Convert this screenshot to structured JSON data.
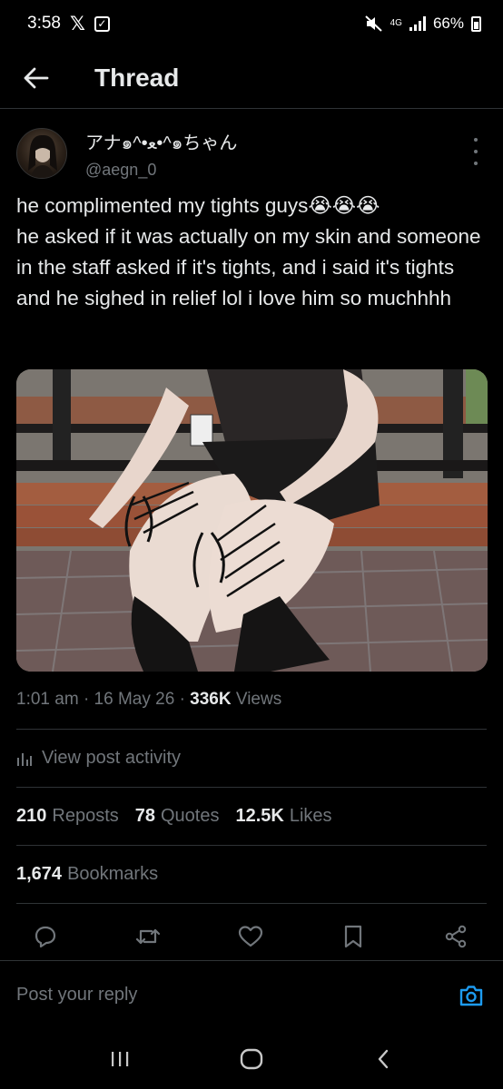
{
  "status_bar": {
    "time": "3:58",
    "network": "4G",
    "battery": "66%"
  },
  "header": {
    "title": "Thread"
  },
  "author": {
    "display_name": "アナ๑^•ﻌ•^๑ちゃん",
    "handle": "@aegn_0"
  },
  "post": {
    "text": "he complimented my tights guys😭😭😭\nhe asked if it was actually on my skin and someone in the staff asked if it's tights, and i said it's tights and he sighed in relief lol i love him so muchhhh",
    "time": "1:01 am",
    "date": "16 May 26",
    "views_count": "336K",
    "views_label": "Views"
  },
  "activity": {
    "label": "View post activity"
  },
  "stats": {
    "reposts_count": "210",
    "reposts_label": "Reposts",
    "quotes_count": "78",
    "quotes_label": "Quotes",
    "likes_count": "12.5K",
    "likes_label": "Likes",
    "bookmarks_count": "1,674",
    "bookmarks_label": "Bookmarks"
  },
  "reply": {
    "placeholder": "Post your reply"
  },
  "colors": {
    "background": "#000000",
    "text_primary": "#e7e9ea",
    "text_secondary": "#71767b",
    "divider": "#2f3336",
    "accent": "#1d9bf0"
  }
}
